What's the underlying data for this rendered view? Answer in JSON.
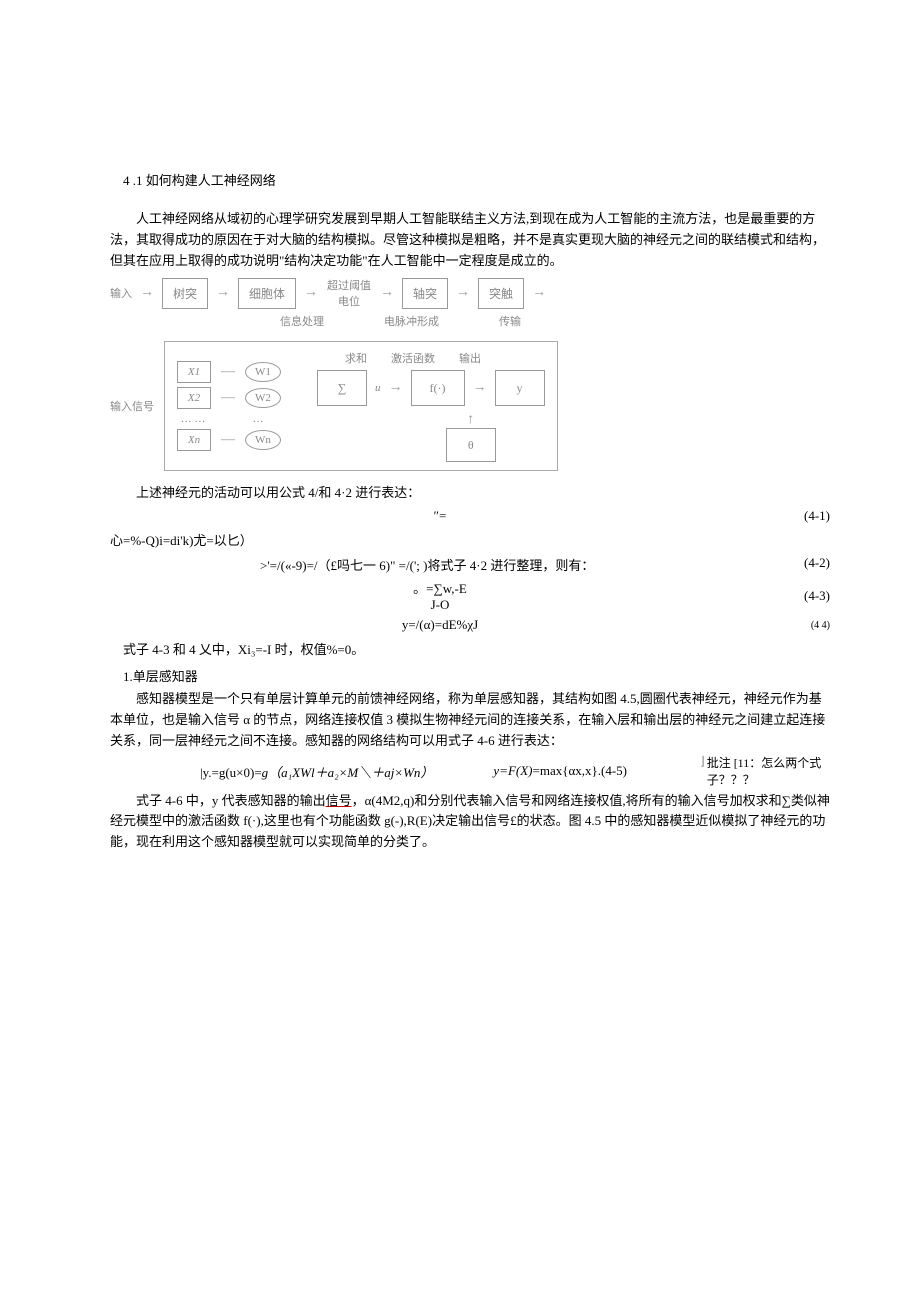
{
  "section_title": "4 .1 如何构建人工神经网络",
  "intro_para": "人工神经网络从域初的心理学研究发展到早期人工智能联结主义方法,到现在成为人工智能的主流方法，也是最重要的方法，其取得成功的原因在于对大脑的结构模拟。尽管这种模拟是粗略，并不是真实更现大脑的神经元之间的联结模式和结构，但其在应用上取得的成功说明\"结构决定功能\"在人工智能中一定程度是成立的。",
  "diagram1": {
    "input": "输入",
    "dendrite": "树突",
    "cell_body": "细胞体",
    "over_threshold": "超过阈值电位",
    "axon": "轴突",
    "synapse": "突触",
    "info_proc": "信息处理",
    "pulse_form": "电脉冲形成",
    "transmit": "传输"
  },
  "diagram2": {
    "input_signal": "输入信号",
    "x1": "X1",
    "x2": "X2",
    "xn": "Xn",
    "w1": "W1",
    "w2": "W2",
    "wn": "Wn",
    "dots": "…  …",
    "sum_label": "求和",
    "act_label": "激活函数",
    "out_label": "输出",
    "sigma": "∑",
    "u": "u",
    "f": "f(·)",
    "y": "y",
    "theta": "θ"
  },
  "line1": "上述神经元的活动可以用公式 4/和 4·2 进行表达：",
  "eq_ueq": "″=",
  "eq41_num": "(4-1)",
  "line2": "心=%-Q)i=di'k)尤=以匕）",
  "eq42_num": "(4-2)",
  "line3": ">'=/(«-9)=/（£吗七一 6)\" =/('; )将式子 4·2 进行整理，则有：",
  "eq43a": "。=∑w,-E",
  "eq43b": "J-O",
  "eq43_num": "(4-3)",
  "eq44": "y=/(α)=dE%χJ",
  "eq44_num": "(4  4)",
  "line4": "式子 4-3 和 4 乂中，Xi₃=-I 时，权值%=0。",
  "subhead1": "1.单层感知器",
  "para2": "感知器模型是一个只有单层计算单元的前馈神经网络，称为单层感知器，其结构如图 4.5,圆圈代表神经元，神经元作为基本单位，也是输入信号 α 的节点，网络连接权值 3 模拟生物神经元间的连接关系，在输入层和输出层的神经元之间建立起连接关系，同一层神经元之间不连接。感知器的网络结构可以用式子 4-6 进行表达：",
  "formula_left": "|y.=g(u×0)=",
  "formula_italic": "g（a₁XWl＋a₂×M＼＋aj×Wn）",
  "formula_right": "y=F(X)=max{αx,x}.(4-5)",
  "comment": "批注  [11：怎么两个式子？？？",
  "para3a": "式子 4-6 中，y 代表感知器的输出",
  "para3_underlined": "信号",
  "para3b": "，α(4M2,q)和分别代表输入信号和网络连接权值,将所有的输入信号加权求和∑类似神经元模型中的激活函数 f(·),这里也有个功能函数 g(-),R(E)决定输出信号£的状态。图 4.5 中的感知器模型近似模拟了神经元的功能，现在利用这个感知器模型就可以实现简单的分类了。"
}
